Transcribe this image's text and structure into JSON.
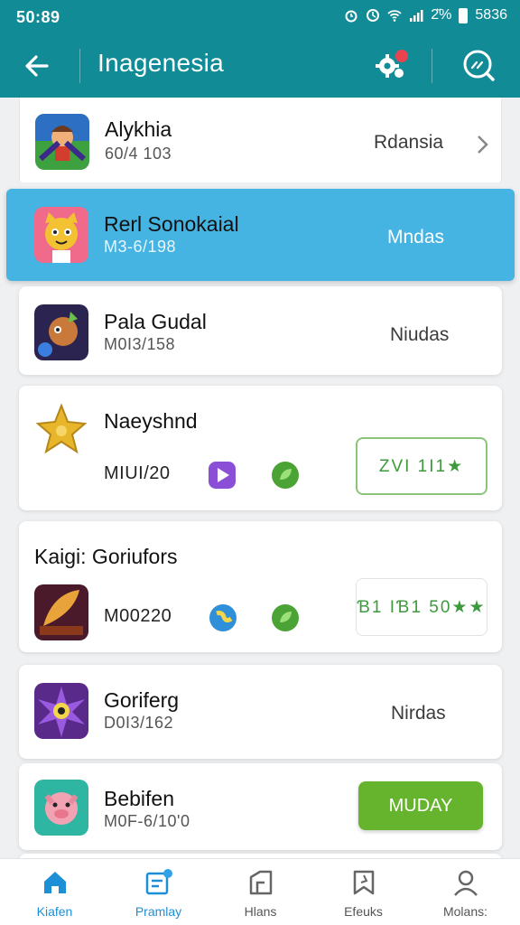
{
  "status_bar": {
    "time": "50:89",
    "battery_text": "2̆%",
    "clock": "5836"
  },
  "app_bar": {
    "title": "Inagenesia"
  },
  "colors": {
    "teal": "#118b96",
    "highlight": "#46b4e2",
    "green": "#66b42d",
    "nav_active": "#1d8fd6"
  },
  "items": [
    {
      "name": "Alykhia",
      "sub": "60/4 103",
      "action": "Rdansia"
    },
    {
      "name": "Rerl Sonokaial",
      "sub": "M3-6/198",
      "action": "Mndas"
    },
    {
      "name": "Pala Gudal",
      "sub": "M0I3/158",
      "action": "Niudas"
    },
    {
      "name": "Naeyshnd",
      "sub": "MIUI/20",
      "action": "ZVI 1I1★"
    },
    {
      "name": "Kaigi: Goriufors",
      "sub": "M00220",
      "action": "Ɓ1 IƁ1 50★★"
    },
    {
      "name": "Goriferg",
      "sub": "D0I3/162",
      "action": "Nirdas"
    },
    {
      "name": "Bebifen",
      "sub": "M0F-6/10'0",
      "action": "MUDAY"
    }
  ],
  "nav": [
    {
      "label": "Kiafen",
      "icon": "home-icon"
    },
    {
      "label": "Pramlay",
      "icon": "playlist-icon"
    },
    {
      "label": "Hlans",
      "icon": "tablet-icon"
    },
    {
      "label": "Efeuks",
      "icon": "bookmark-icon"
    },
    {
      "label": "Molans:",
      "icon": "profile-icon"
    }
  ]
}
